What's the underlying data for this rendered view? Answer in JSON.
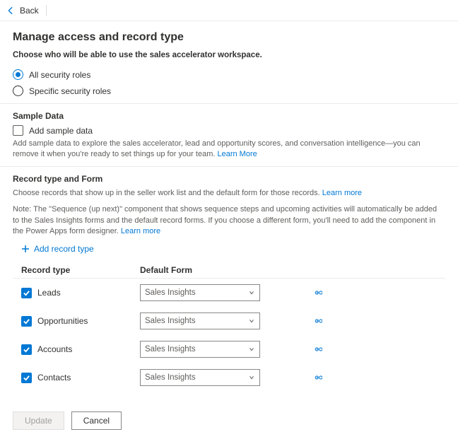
{
  "nav": {
    "back": "Back"
  },
  "title": "Manage access and record type",
  "subhead": "Choose who will be able to use the sales accelerator workspace.",
  "roles": {
    "all": "All security roles",
    "specific": "Specific security roles"
  },
  "sample": {
    "title": "Sample Data",
    "checkbox_label": "Add sample data",
    "helper": "Add sample data to explore the sales accelerator, lead and opportunity scores, and conversation intelligence—you can remove it when you're ready to set things up for your team.",
    "learn": "Learn More"
  },
  "record": {
    "title": "Record type and Form",
    "line1": "Choose records that show up in the seller work list and the default form for those records.",
    "learn1": "Learn more",
    "line2": "Note: The \"Sequence (up next)\" component that shows sequence steps and upcoming activities will automatically be added to the Sales Insights forms and the default record forms. If you choose a different form, you'll need to add the component in the Power Apps form designer.",
    "learn2": "Learn more",
    "add": "Add record type",
    "col_type": "Record type",
    "col_form": "Default Form",
    "rows": [
      {
        "label": "Leads",
        "form": "Sales Insights"
      },
      {
        "label": "Opportunities",
        "form": "Sales Insights"
      },
      {
        "label": "Accounts",
        "form": "Sales Insights"
      },
      {
        "label": "Contacts",
        "form": "Sales Insights"
      }
    ]
  },
  "footer": {
    "update": "Update",
    "cancel": "Cancel"
  }
}
